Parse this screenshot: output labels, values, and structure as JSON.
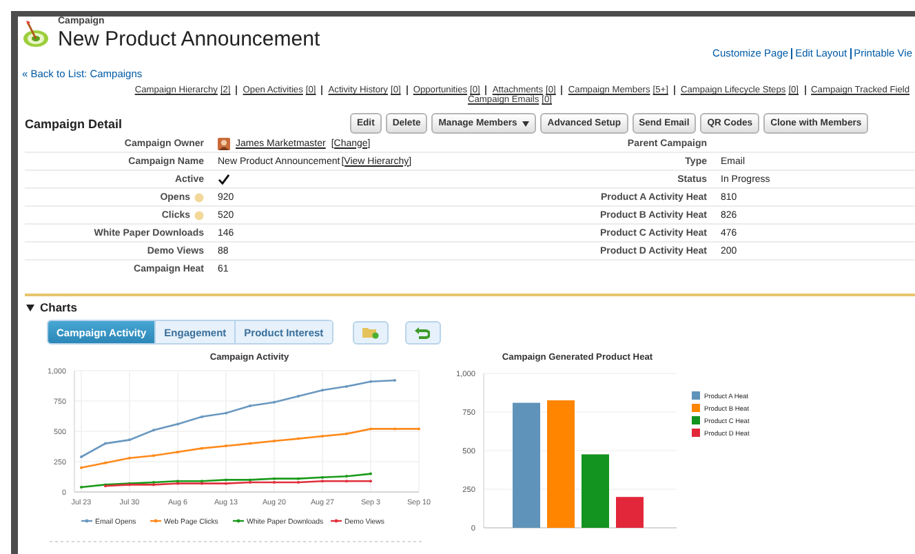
{
  "header": {
    "object_type": "Campaign",
    "title": "New Product Announcement",
    "page_links": [
      "Customize Page",
      "Edit Layout",
      "Printable Vie"
    ],
    "back_link": "« Back to List: Campaigns"
  },
  "related_link_rows": [
    {
      "links": [
        {
          "label": "Campaign Hierarchy",
          "count": "[2]"
        },
        {
          "label": "Open Activities",
          "count": "[0]"
        },
        {
          "label": "Activity History",
          "count": "[0]"
        },
        {
          "label": "Opportunities",
          "count": "[0]"
        },
        {
          "label": "Attachments",
          "count": "[0]"
        },
        {
          "label": "Campaign Members",
          "count": "[5+]"
        },
        {
          "label": "Campaign Lifecycle Steps",
          "count": "[0]"
        },
        {
          "label": "Campaign Tracked Field"
        }
      ]
    },
    {
      "links": [
        {
          "label": "Campaign Emails",
          "count": "[0]"
        }
      ]
    }
  ],
  "detail": {
    "title": "Campaign Detail",
    "buttons": [
      {
        "label": "Edit"
      },
      {
        "label": "Delete"
      },
      {
        "label": "Manage Members",
        "kind": "menu"
      },
      {
        "label": "Advanced Setup"
      },
      {
        "label": "Send Email"
      },
      {
        "label": "QR Codes"
      },
      {
        "label": "Clone with Members"
      }
    ],
    "left_fields": [
      {
        "label": "Campaign Owner",
        "kind": "owner",
        "value": "James Marketmaster",
        "link": "[Change]"
      },
      {
        "label": "Campaign Name",
        "kind": "name",
        "value": "New Product Announcement",
        "link": "[View Hierarchy]"
      },
      {
        "label": "Active",
        "kind": "checkbox",
        "checked": true
      },
      {
        "label": "Opens",
        "kind": "info",
        "value": "920"
      },
      {
        "label": "Clicks",
        "kind": "info",
        "value": "520"
      },
      {
        "label": "White Paper Downloads",
        "kind": "text",
        "value": "146"
      },
      {
        "label": "Demo Views",
        "kind": "text",
        "value": "88"
      },
      {
        "label": "Campaign Heat",
        "kind": "text",
        "value": "61"
      }
    ],
    "right_fields": [
      {
        "label": "Parent Campaign"
      },
      {
        "label": "Type",
        "value": "Email"
      },
      {
        "label": "Status",
        "value": "In Progress"
      },
      {
        "label": "Product A Activity Heat",
        "value": "810"
      },
      {
        "label": "Product B Activity Heat",
        "value": "826"
      },
      {
        "label": "Product C Activity Heat",
        "value": "476"
      },
      {
        "label": "Product D Activity Heat",
        "value": "200"
      }
    ]
  },
  "charts": {
    "title": "Charts",
    "expanded": true,
    "tabs": [
      {
        "label": "Campaign Activity",
        "selected": true
      },
      {
        "label": "Engagement",
        "selected": false
      },
      {
        "label": "Product Interest",
        "selected": false
      }
    ],
    "line_chart": {
      "chart_data": {
        "type": "line",
        "title": "Campaign Activity",
        "categories": [
          "Jul 23",
          null,
          "Jul 30",
          null,
          "Aug 6",
          null,
          "Aug 13",
          null,
          "Aug 20",
          null,
          "Aug 27",
          null,
          "Sep 3",
          null,
          "Sep 10"
        ],
        "series": [
          {
            "name": "Email Opens",
            "color": "#6a98c0",
            "values": [
              290,
              400,
              430,
              510,
              560,
              620,
              650,
              710,
              740,
              790,
              840,
              870,
              910,
              920,
              null
            ]
          },
          {
            "name": "Web Page Clicks",
            "color": "#ff8a1c",
            "values": [
              200,
              240,
              280,
              300,
              330,
              360,
              380,
              400,
              420,
              440,
              460,
              480,
              520,
              520,
              520
            ]
          },
          {
            "name": "White Paper Downloads",
            "color": "#1a9a1a",
            "values": [
              40,
              60,
              70,
              80,
              90,
              90,
              100,
              100,
              110,
              110,
              120,
              130,
              150,
              null,
              null
            ]
          },
          {
            "name": "Demo Views",
            "color": "#e0303c",
            "values": [
              null,
              50,
              60,
              60,
              70,
              70,
              70,
              80,
              80,
              80,
              90,
              90,
              90,
              null,
              null
            ]
          }
        ],
        "ylim": [
          0,
          1000
        ],
        "grid": true,
        "legend": "bottom",
        "yticks": [
          0,
          250,
          500,
          750,
          {
            "value": 1000,
            "label": "1,000"
          }
        ]
      }
    },
    "bar_chart": {
      "chart_data": {
        "type": "bar",
        "title": "Campaign Generated Product Heat",
        "series": [
          {
            "name": "Product A Heat",
            "color": "#5f93b9",
            "values": [
              810
            ]
          },
          {
            "name": "Product B Heat",
            "color": "#ff8500",
            "values": [
              826
            ]
          },
          {
            "name": "Product C Heat",
            "color": "#13931f",
            "values": [
              476
            ]
          },
          {
            "name": "Product D Heat",
            "color": "#e2273a",
            "values": [
              200
            ]
          }
        ],
        "ylim": [
          0,
          1000
        ],
        "grid": true,
        "legend": "right",
        "yticks": [
          0,
          250,
          500,
          750,
          {
            "value": 1000,
            "label": "1,000"
          }
        ]
      }
    }
  }
}
